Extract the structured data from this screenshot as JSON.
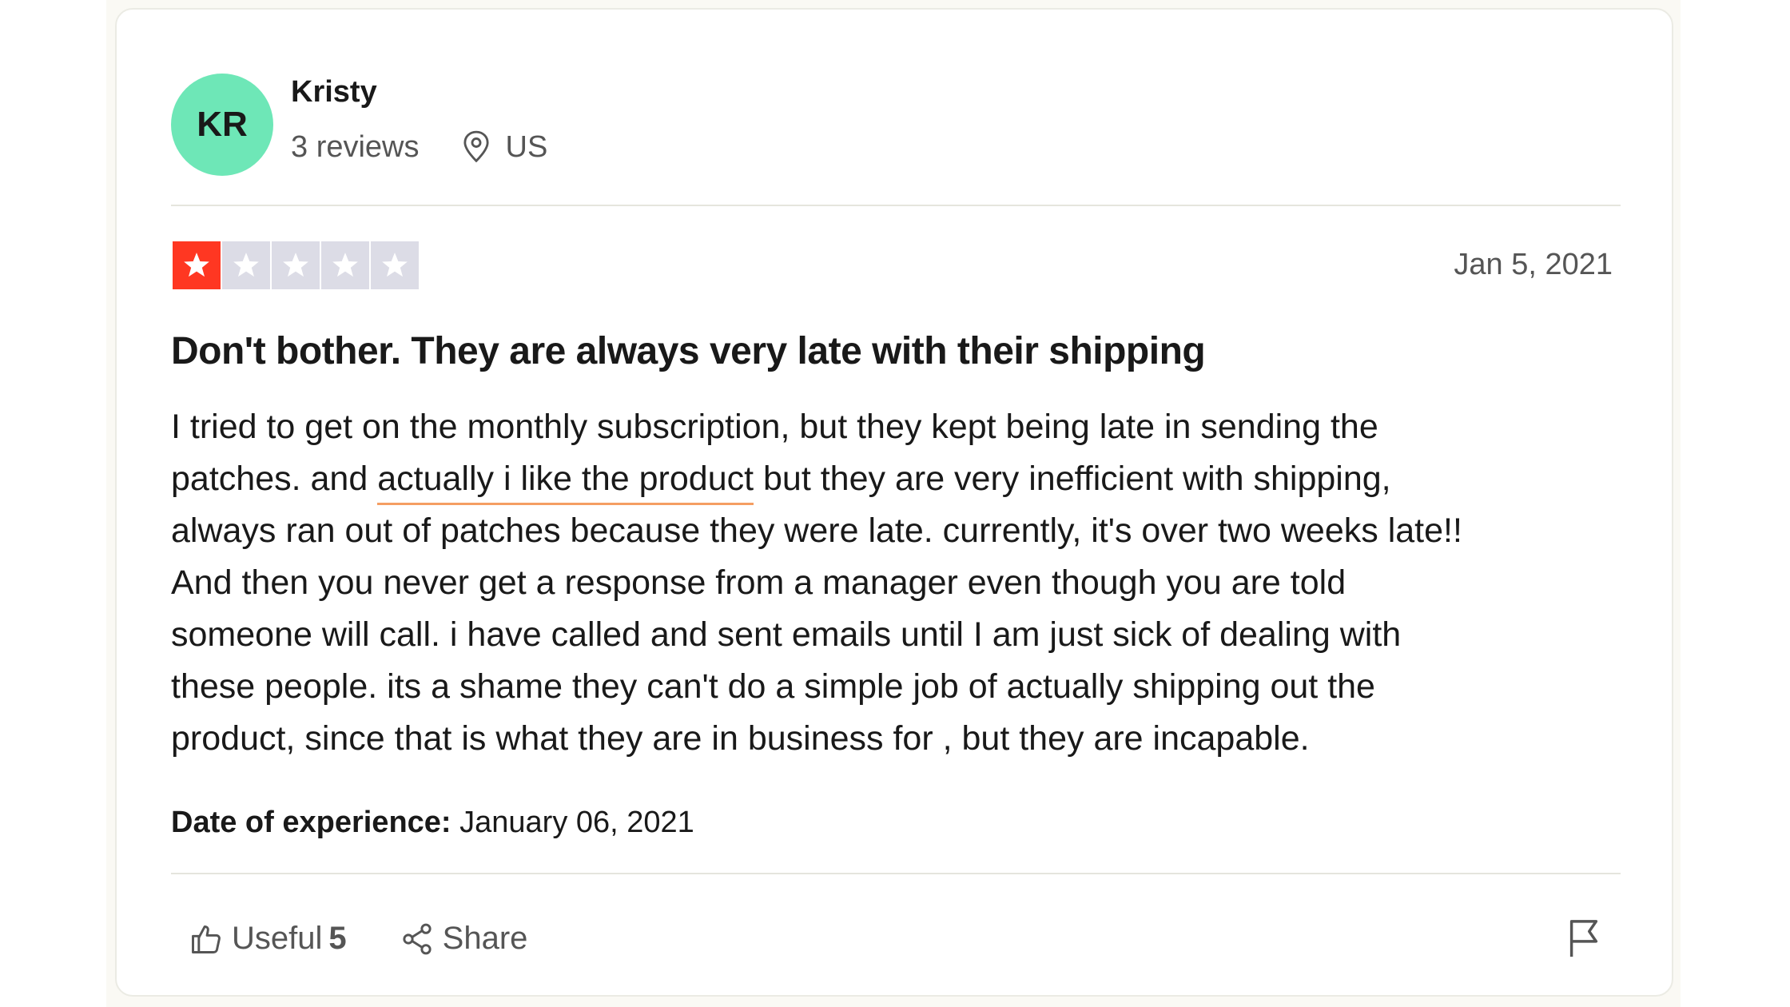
{
  "reviewer": {
    "initials": "KR",
    "name": "Kristy",
    "review_count": "3 reviews",
    "location": "US",
    "avatar_color": "#6ee7b7"
  },
  "rating": {
    "stars": 1,
    "max": 5,
    "filled_color": "#ff3722",
    "empty_color": "#dcdce6"
  },
  "review": {
    "date": "Jan 5, 2021",
    "title": "Don't bother. They are always very late with their shipping",
    "body": {
      "line1": "I tried to get on the monthly subscription, but they kept being late in sending the",
      "line2_pre": "patches. and ",
      "line2_highlight": "actually i like the product",
      "line2_post": " but they are very inefficient with shipping,",
      "line3": "always ran out of patches because they were late. currently, it's over two weeks late!!",
      "line4": "And then you never get a response from a manager even though you are told",
      "line5": "someone will call. i have called and sent emails until I am just sick of dealing with",
      "line6": "these people. its a shame they can't do a simple job of actually shipping out the",
      "line7": "product, since that is what they are in business for , but they are incapable."
    },
    "experience_label": "Date of experience:",
    "experience_date": " January 06, 2021",
    "highlight_color": "#f59e63"
  },
  "actions": {
    "useful_label": "Useful",
    "useful_count": "5",
    "share_label": "Share",
    "thumb_icon": "thumbs-up-icon",
    "share_icon": "share-icon",
    "flag_icon": "flag-icon"
  }
}
